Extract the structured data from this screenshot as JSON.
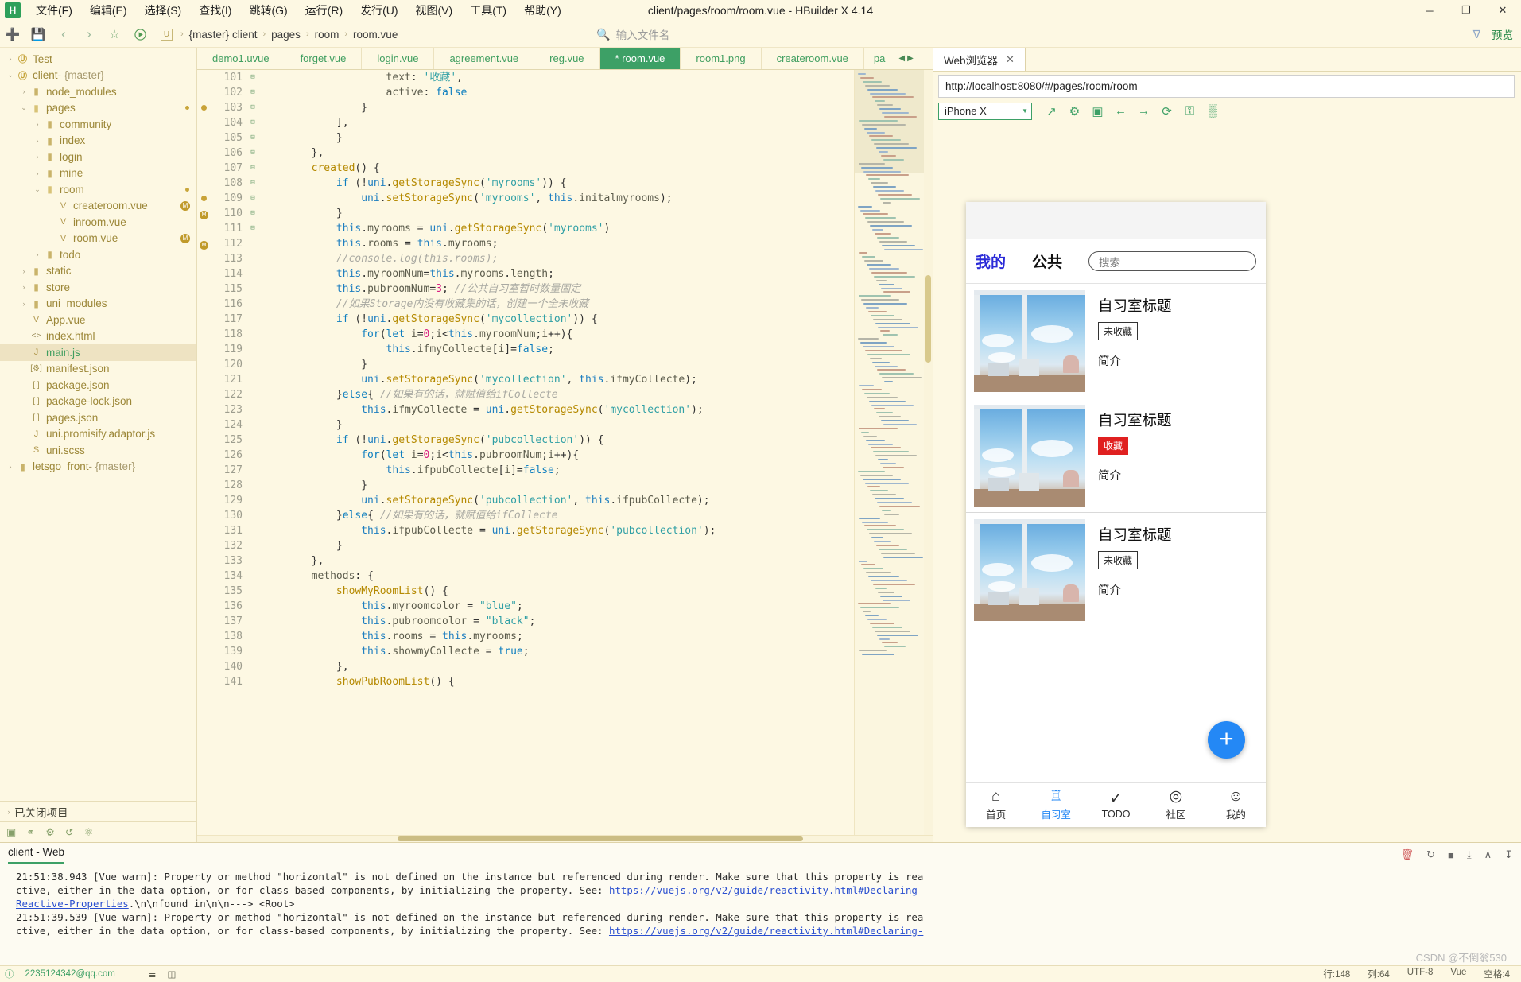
{
  "window": {
    "title": "client/pages/room/room.vue - HBuilder X 4.14",
    "logo": "H",
    "minimize": "─",
    "maximize": "❐",
    "close": "✕"
  },
  "menubar": [
    {
      "label": "文件(F)",
      "name": "menu-file"
    },
    {
      "label": "编辑(E)",
      "name": "menu-edit"
    },
    {
      "label": "选择(S)",
      "name": "menu-select"
    },
    {
      "label": "查找(I)",
      "name": "menu-find"
    },
    {
      "label": "跳转(G)",
      "name": "menu-goto"
    },
    {
      "label": "运行(R)",
      "name": "menu-run"
    },
    {
      "label": "发行(U)",
      "name": "menu-publish"
    },
    {
      "label": "视图(V)",
      "name": "menu-view"
    },
    {
      "label": "工具(T)",
      "name": "menu-tools"
    },
    {
      "label": "帮助(Y)",
      "name": "menu-help"
    }
  ],
  "toolbar": {
    "new_file_icon": "➕",
    "save_icon": "💾",
    "back_icon": "‹",
    "forward_icon": "›",
    "star_icon": "☆",
    "run_icon": "▶",
    "breadcrumb_icon": "U",
    "breadcrumb": [
      "{master}",
      "client",
      "pages",
      "room",
      "room.vue"
    ],
    "breadcrumb_sep": "›",
    "file_search_icon": "🔍",
    "file_search_placeholder": "输入文件名",
    "funnel_icon": "∇",
    "preview_label": "预览"
  },
  "sidebar": {
    "tree": [
      {
        "label": "Test",
        "depth": 0,
        "arrow": "›",
        "icon": "proj",
        "icon_glyph": "Ⓤ",
        "style": "lbl"
      },
      {
        "label": "client",
        "suffix": " - {master}",
        "depth": 0,
        "arrow": "⌄",
        "icon": "proj",
        "icon_glyph": "Ⓤ",
        "style": "lbl"
      },
      {
        "label": "node_modules",
        "depth": 1,
        "arrow": "›",
        "icon": "folder",
        "icon_glyph": "▮",
        "style": "lbl"
      },
      {
        "label": "pages",
        "depth": 1,
        "arrow": "⌄",
        "icon": "folder-open",
        "icon_glyph": "▮",
        "style": "lbl",
        "dot": true
      },
      {
        "label": "community",
        "depth": 2,
        "arrow": "›",
        "icon": "folder",
        "icon_glyph": "▮",
        "style": "lbl"
      },
      {
        "label": "index",
        "depth": 2,
        "arrow": "›",
        "icon": "folder",
        "icon_glyph": "▮",
        "style": "lbl"
      },
      {
        "label": "login",
        "depth": 2,
        "arrow": "›",
        "icon": "folder",
        "icon_glyph": "▮",
        "style": "lbl"
      },
      {
        "label": "mine",
        "depth": 2,
        "arrow": "›",
        "icon": "folder",
        "icon_glyph": "▮",
        "style": "lbl"
      },
      {
        "label": "room",
        "depth": 2,
        "arrow": "⌄",
        "icon": "folder-open",
        "icon_glyph": "▮",
        "style": "lbl",
        "dot": true
      },
      {
        "label": "createroom.vue",
        "depth": 3,
        "arrow": "",
        "icon": "vue",
        "icon_glyph": "V",
        "style": "lbl",
        "badge": "M"
      },
      {
        "label": "inroom.vue",
        "depth": 3,
        "arrow": "",
        "icon": "vue",
        "icon_glyph": "V",
        "style": "lbl"
      },
      {
        "label": "room.vue",
        "depth": 3,
        "arrow": "",
        "icon": "vue",
        "icon_glyph": "V",
        "style": "lbl",
        "badge": "M"
      },
      {
        "label": "todo",
        "depth": 2,
        "arrow": "›",
        "icon": "folder",
        "icon_glyph": "▮",
        "style": "lbl"
      },
      {
        "label": "static",
        "depth": 1,
        "arrow": "›",
        "icon": "folder",
        "icon_glyph": "▮",
        "style": "lbl"
      },
      {
        "label": "store",
        "depth": 1,
        "arrow": "›",
        "icon": "folder",
        "icon_glyph": "▮",
        "style": "lbl"
      },
      {
        "label": "uni_modules",
        "depth": 1,
        "arrow": "›",
        "icon": "folder",
        "icon_glyph": "▮",
        "style": "lbl"
      },
      {
        "label": "App.vue",
        "depth": 1,
        "arrow": "",
        "icon": "vue",
        "icon_glyph": "V",
        "style": "lbl"
      },
      {
        "label": "index.html",
        "depth": 1,
        "arrow": "",
        "icon": "code",
        "icon_glyph": "<>",
        "style": "lbl"
      },
      {
        "label": "main.js",
        "depth": 1,
        "arrow": "",
        "icon": "js",
        "icon_glyph": "J",
        "style": "lbl green",
        "selected": true
      },
      {
        "label": "manifest.json",
        "depth": 1,
        "arrow": "",
        "icon": "json",
        "icon_glyph": "[⚙]",
        "style": "lbl"
      },
      {
        "label": "package.json",
        "depth": 1,
        "arrow": "",
        "icon": "json",
        "icon_glyph": "[ ]",
        "style": "lbl"
      },
      {
        "label": "package-lock.json",
        "depth": 1,
        "arrow": "",
        "icon": "json",
        "icon_glyph": "[ ]",
        "style": "lbl"
      },
      {
        "label": "pages.json",
        "depth": 1,
        "arrow": "",
        "icon": "json",
        "icon_glyph": "[ ]",
        "style": "lbl"
      },
      {
        "label": "uni.promisify.adaptor.js",
        "depth": 1,
        "arrow": "",
        "icon": "js",
        "icon_glyph": "J",
        "style": "lbl"
      },
      {
        "label": "uni.scss",
        "depth": 1,
        "arrow": "",
        "icon": "scss",
        "icon_glyph": "S",
        "style": "lbl"
      },
      {
        "label": "letsgo_front",
        "suffix": " - {master}",
        "depth": 0,
        "arrow": "›",
        "icon": "folder",
        "icon_glyph": "▮",
        "style": "lbl"
      }
    ],
    "closed_projects_label": "已关闭项目",
    "closed_projects_arrow": "›",
    "footer_icons": [
      "terminal-icon",
      "link-icon",
      "bug-icon",
      "refresh-icon",
      "plugin-icon"
    ]
  },
  "editor": {
    "tabs": [
      {
        "label": "demo1.uvue",
        "active": false
      },
      {
        "label": "forget.vue",
        "active": false
      },
      {
        "label": "login.vue",
        "active": false
      },
      {
        "label": "agreement.vue",
        "active": false
      },
      {
        "label": "reg.vue",
        "active": false
      },
      {
        "label": "* room.vue",
        "active": true
      },
      {
        "label": "room1.png",
        "active": false
      },
      {
        "label": "createroom.vue",
        "active": false
      },
      {
        "label": "pa",
        "active": false
      }
    ],
    "tabnav_left": "◀",
    "tabnav_right": "▶",
    "first_line": 101,
    "lines": [
      {
        "no": 101,
        "fold": "",
        "mark": "",
        "text": "                    text: '收藏',"
      },
      {
        "no": 102,
        "fold": "",
        "mark": "",
        "text": "                    active: false"
      },
      {
        "no": 103,
        "fold": "",
        "mark": "dot",
        "text": "                }"
      },
      {
        "no": 104,
        "fold": "",
        "mark": "",
        "text": "            ],"
      },
      {
        "no": 105,
        "fold": "",
        "mark": "",
        "text": "            }"
      },
      {
        "no": 106,
        "fold": "",
        "mark": "",
        "text": "        },"
      },
      {
        "no": 107,
        "fold": "⊟",
        "mark": "",
        "text": "        created() {"
      },
      {
        "no": 108,
        "fold": "⊟",
        "mark": "",
        "text": "            if (!uni.getStorageSync('myrooms')) {"
      },
      {
        "no": 109,
        "fold": "",
        "mark": "dot",
        "text": "                uni.setStorageSync('myrooms', this.initalmyrooms);"
      },
      {
        "no": 110,
        "fold": "",
        "mark": "m",
        "text": "            }"
      },
      {
        "no": 111,
        "fold": "",
        "mark": "",
        "text": "            this.myrooms = uni.getStorageSync('myrooms')"
      },
      {
        "no": 112,
        "fold": "",
        "mark": "m",
        "text": "            this.rooms = this.myrooms;"
      },
      {
        "no": 113,
        "fold": "",
        "mark": "",
        "text": "            //console.log(this.rooms);"
      },
      {
        "no": 114,
        "fold": "",
        "mark": "",
        "text": "            this.myroomNum=this.myrooms.length;"
      },
      {
        "no": 115,
        "fold": "",
        "mark": "",
        "text": "            this.pubroomNum=3; //公共自习室暂时数量固定"
      },
      {
        "no": 116,
        "fold": "",
        "mark": "",
        "text": "            //如果Storage内没有收藏集的话，创建一个全未收藏"
      },
      {
        "no": 117,
        "fold": "⊟",
        "mark": "",
        "text": "            if (!uni.getStorageSync('mycollection')) {"
      },
      {
        "no": 118,
        "fold": "⊟",
        "mark": "",
        "text": "                for(let i=0;i<this.myroomNum;i++){"
      },
      {
        "no": 119,
        "fold": "",
        "mark": "",
        "text": "                    this.ifmyCollecte[i]=false;"
      },
      {
        "no": 120,
        "fold": "",
        "mark": "",
        "text": "                }"
      },
      {
        "no": 121,
        "fold": "",
        "mark": "",
        "text": "                uni.setStorageSync('mycollection', this.ifmyCollecte);"
      },
      {
        "no": 122,
        "fold": "⊟",
        "mark": "",
        "text": "            }else{ //如果有的话，就赋值给ifCollecte"
      },
      {
        "no": 123,
        "fold": "",
        "mark": "",
        "text": "                this.ifmyCollecte = uni.getStorageSync('mycollection');"
      },
      {
        "no": 124,
        "fold": "",
        "mark": "",
        "text": "            }"
      },
      {
        "no": 125,
        "fold": "⊟",
        "mark": "",
        "text": "            if (!uni.getStorageSync('pubcollection')) {"
      },
      {
        "no": 126,
        "fold": "⊟",
        "mark": "",
        "text": "                for(let i=0;i<this.pubroomNum;i++){"
      },
      {
        "no": 127,
        "fold": "",
        "mark": "",
        "text": "                    this.ifpubCollecte[i]=false;"
      },
      {
        "no": 128,
        "fold": "",
        "mark": "",
        "text": "                }"
      },
      {
        "no": 129,
        "fold": "",
        "mark": "",
        "text": "                uni.setStorageSync('pubcollection', this.ifpubCollecte);"
      },
      {
        "no": 130,
        "fold": "⊟",
        "mark": "",
        "text": "            }else{ //如果有的话，就赋值给ifCollecte"
      },
      {
        "no": 131,
        "fold": "",
        "mark": "",
        "text": "                this.ifpubCollecte = uni.getStorageSync('pubcollection');"
      },
      {
        "no": 132,
        "fold": "",
        "mark": "",
        "text": "            }"
      },
      {
        "no": 133,
        "fold": "",
        "mark": "",
        "text": "        },"
      },
      {
        "no": 134,
        "fold": "⊟",
        "mark": "",
        "text": "        methods: {"
      },
      {
        "no": 135,
        "fold": "⊟",
        "mark": "",
        "text": "            showMyRoomList() {"
      },
      {
        "no": 136,
        "fold": "",
        "mark": "",
        "text": "                this.myroomcolor = \"blue\";"
      },
      {
        "no": 137,
        "fold": "",
        "mark": "",
        "text": "                this.pubroomcolor = \"black\";"
      },
      {
        "no": 138,
        "fold": "",
        "mark": "",
        "text": "                this.rooms = this.myrooms;"
      },
      {
        "no": 139,
        "fold": "",
        "mark": "",
        "text": "                this.showmyCollecte = true;"
      },
      {
        "no": 140,
        "fold": "",
        "mark": "",
        "text": "            },"
      },
      {
        "no": 141,
        "fold": "⊟",
        "mark": "",
        "text": "            showPubRoomList() {"
      }
    ]
  },
  "preview": {
    "tab_label": "Web浏览器",
    "tab_close": "✕",
    "url": "http://localhost:8080/#/pages/room/room",
    "device": "iPhone X",
    "device_caret": "▼",
    "icons": [
      {
        "name": "open-external-icon",
        "glyph": "↗"
      },
      {
        "name": "gear-icon",
        "glyph": "⚙"
      },
      {
        "name": "console-icon",
        "glyph": "▣"
      },
      {
        "name": "back-arrow-icon",
        "glyph": "←"
      },
      {
        "name": "forward-arrow-icon",
        "glyph": "→"
      },
      {
        "name": "reload-icon",
        "glyph": "⟳"
      },
      {
        "name": "lock-icon",
        "glyph": "⚿"
      },
      {
        "name": "qr-code-icon",
        "glyph": "▒"
      }
    ]
  },
  "phone": {
    "tab_mine": "我的",
    "tab_public": "公共",
    "search_placeholder": "搜索",
    "cards": [
      {
        "title": "自习室标题",
        "badge": "未收藏",
        "favorited": false,
        "desc": "简介"
      },
      {
        "title": "自习室标题",
        "badge": "收藏",
        "favorited": true,
        "desc": "简介"
      },
      {
        "title": "自习室标题",
        "badge": "未收藏",
        "favorited": false,
        "desc": "简介"
      }
    ],
    "fab": "+",
    "nav": [
      {
        "label": "首页",
        "icon": "⌂",
        "name": "nav-home",
        "active": false
      },
      {
        "label": "自习室",
        "icon": "♖",
        "name": "nav-studyroom",
        "active": true
      },
      {
        "label": "TODO",
        "icon": "✓",
        "name": "nav-todo",
        "active": false
      },
      {
        "label": "社区",
        "icon": "◎",
        "name": "nav-community",
        "active": false
      },
      {
        "label": "我的",
        "icon": "☺",
        "name": "nav-mine",
        "active": false
      }
    ]
  },
  "console": {
    "tab": "client - Web",
    "tools": [
      {
        "name": "clear-icon",
        "glyph": "🗑",
        "red": true
      },
      {
        "name": "restart-icon",
        "glyph": "↻",
        "red": false
      },
      {
        "name": "stop-icon",
        "glyph": "■",
        "red": false
      },
      {
        "name": "export-icon",
        "glyph": "⤓",
        "red": false
      },
      {
        "name": "collapse-icon",
        "glyph": "∧",
        "red": false
      },
      {
        "name": "scroll-end-icon",
        "glyph": "↧",
        "red": false
      }
    ],
    "messages": [
      "21:51:38.943 [Vue warn]: Property or method \"horizontal\" is not defined on the instance but referenced during render. Make sure that this property is rea",
      "ctive, either in the data option, or for class-based components, by initializing the property. See: ",
      "21:51:39.539 [Vue warn]: Property or method \"horizontal\" is not defined on the instance but referenced during render. Make sure that this property is rea",
      "ctive, either in the data option, or for class-based components, by initializing the property. See: "
    ],
    "link": "https://vuejs.org/v2/guide/reactivity.html#Declaring-",
    "link2": "Reactive-Properties",
    "tail": ".\\n\\nfound in\\n\\n---> <Root>"
  },
  "status": {
    "account_icon": "ⓘ",
    "account": "2235124342@qq.com",
    "left_icons": [
      "list-icon",
      "terminal-icon"
    ],
    "cursor": "行:148",
    "column": "列:64",
    "encoding": "UTF-8",
    "language": "Vue",
    "spaces": "空格:4"
  },
  "watermark": "CSDN @不倒翁530",
  "colors": {
    "accent_green": "#3da066",
    "bg": "#fdf8e3",
    "active_blue": "#2488f5",
    "fav_red": "#e02020"
  }
}
